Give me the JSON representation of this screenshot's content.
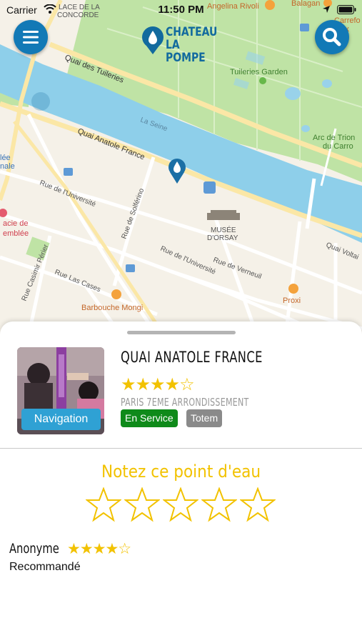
{
  "status_bar": {
    "carrier": "Carrier",
    "time": "11:50 PM"
  },
  "app": {
    "brand_line1": "CHATEAU",
    "brand_line2": "LA POMPE",
    "brand_color": "#126a9e",
    "accent_color": "#1279b6",
    "menu_icon": "menu-icon",
    "search_icon": "search-icon"
  },
  "map": {
    "labels": {
      "place_concorde": "LACE DE LA",
      "concorde": "CONCORDE",
      "angelina": "Angelina Rivoli",
      "balagan": "Balagan",
      "carrefour": "Carrefo",
      "carrefour2": "Ex",
      "quai_tuileries": "Quai des Tuileries",
      "tuileries_garden": "Tuileries Garden",
      "la_seine": "La Seine",
      "quai_anatole": "Quai Anatole France",
      "arc_triomphe": "Arc de Trion",
      "carrousel": "du Carro",
      "lee": "lée",
      "onale": "nale",
      "universite_w": "Rue de l'Université",
      "solferino": "Rue de Solférino",
      "musee1": "MUSÉE",
      "musee2": "D'ORSAY",
      "pharmacie1": "acie de",
      "pharmacie2": "emblée",
      "casimir": "Rue Casimir Périer",
      "las_cases": "Rue Las Cases",
      "universite_e": "Rue de l'Université",
      "verneuil": "Rue de Verneuil",
      "quai_voltaire": "Quai Voltai",
      "barbouche": "Barbouche Mongi",
      "proxi": "Proxi"
    }
  },
  "sheet": {
    "title": "QUAI ANATOLE FRANCE",
    "rating": 4,
    "rating_max": 5,
    "stars_text": "★★★★☆",
    "subtitle": "PARIS 7EME ARRONDISSEMENT",
    "navigation_label": "Navigation",
    "badge_status": "En Service",
    "badge_type": "Totem",
    "status_color": "#0f8a1a",
    "type_color": "#8a8a8a",
    "rate_title": "Notez ce point d'eau",
    "rate_stars": 5,
    "review": {
      "author": "Anonyme",
      "rating": 4,
      "stars_text": "★★★★☆",
      "text": "Recommandé"
    }
  }
}
